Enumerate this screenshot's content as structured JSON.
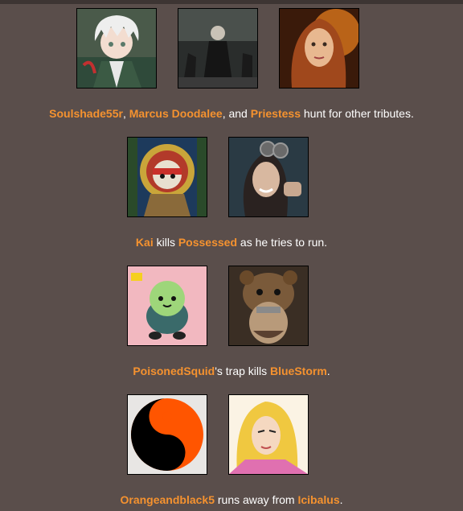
{
  "colors": {
    "background": "#5a4e4b",
    "name_highlight": "#f5922f",
    "text": "#ffffff"
  },
  "events": [
    {
      "avatars": [
        {
          "icon": "white-haired-anime-boy-portrait"
        },
        {
          "icon": "dark-cloaked-figure-portrait"
        },
        {
          "icon": "red-haired-woman-portrait"
        }
      ],
      "caption": {
        "name1": "Soulshade55r",
        "sep1": ", ",
        "name2": "Marcus Doodalee",
        "sep2": ", and ",
        "name3": "Priestess",
        "tail": " hunt for other tributes."
      }
    },
    {
      "avatars": [
        {
          "icon": "countryball-saint-icon-portrait"
        },
        {
          "icon": "woman-with-goggles-portrait"
        }
      ],
      "caption": {
        "name1": "Kai",
        "mid": " kills ",
        "name2": "Possessed",
        "tail": " as he tries to run."
      }
    },
    {
      "avatars": [
        {
          "icon": "green-blob-cartoon-portrait"
        },
        {
          "icon": "bear-helmet-warrior-portrait"
        }
      ],
      "caption": {
        "name1": "PoisonedSquid",
        "mid": "'s trap kills ",
        "name2": "BlueStorm",
        "tail": "."
      }
    },
    {
      "avatars": [
        {
          "icon": "orange-yin-yang-portrait"
        },
        {
          "icon": "blonde-anime-character-portrait"
        }
      ],
      "caption": {
        "name1": "Orangeandblack5",
        "mid": " runs away from ",
        "name2": "Icibalus",
        "tail": "."
      }
    }
  ]
}
